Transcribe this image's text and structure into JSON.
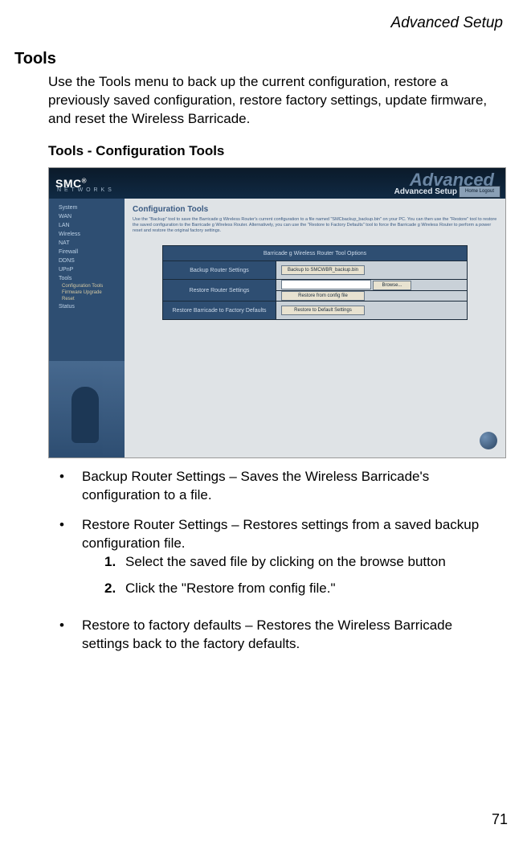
{
  "header": {
    "section": "Advanced Setup"
  },
  "h1": "Tools",
  "intro": "Use the Tools menu to back up the current configuration, restore a previously saved configuration, restore factory settings, update firmware, and reset the Wireless Barricade.",
  "h2": "Tools - Configuration Tools",
  "screenshot": {
    "logo": "SMC",
    "logo_sub": "N E T W O R K S",
    "adv_watermark": "Advanced",
    "adv_label": "Advanced Setup",
    "home_btn": "Home   Logout",
    "nav": [
      "System",
      "WAN",
      "LAN",
      "Wireless",
      "NAT",
      "Firewall",
      "DDNS",
      "UPnP",
      "Tools"
    ],
    "subnav": [
      "Configuration Tools",
      "Firmware Upgrade",
      "Reset"
    ],
    "nav_status": "Status",
    "title": "Configuration Tools",
    "desc": "Use the \"Backup\" tool to save the Barricade g Wireless Router's current configuration to a file named \"SMCbackup_backup.bin\" on your PC. You can then use the \"Restore\" tool to restore the saved configuration to the Barricade g Wireless Router. Alternatively, you can use the \"Restore to Factory Defaults\" tool to force the Barricade g Wireless Router to perform a power reset and restore the original factory settings.",
    "table_header": "Barricade g Wireless Router Tool Options",
    "rows": {
      "backup_label": "Backup Router Settings",
      "backup_btn": "Backup to SMCWBR_backup.bin",
      "restore_label": "Restore Router Settings",
      "restore_browse": "Browse...",
      "restore_btn": "Restore from config file",
      "factory_label": "Restore Barricade to Factory Defaults",
      "factory_btn": "Restore to Default Settings"
    }
  },
  "bullets": {
    "b1": "Backup Router Settings – Saves the Wireless Barricade's configuration to a file.",
    "b2": "Restore Router Settings – Restores settings from a saved backup configuration file.",
    "b2_steps": {
      "s1": "Select the saved file by clicking on the browse button",
      "s2": "Click the \"Restore from config file.\""
    },
    "b3": "Restore to factory defaults – Restores the Wireless Barricade settings back to the factory defaults."
  },
  "page_number": "71"
}
